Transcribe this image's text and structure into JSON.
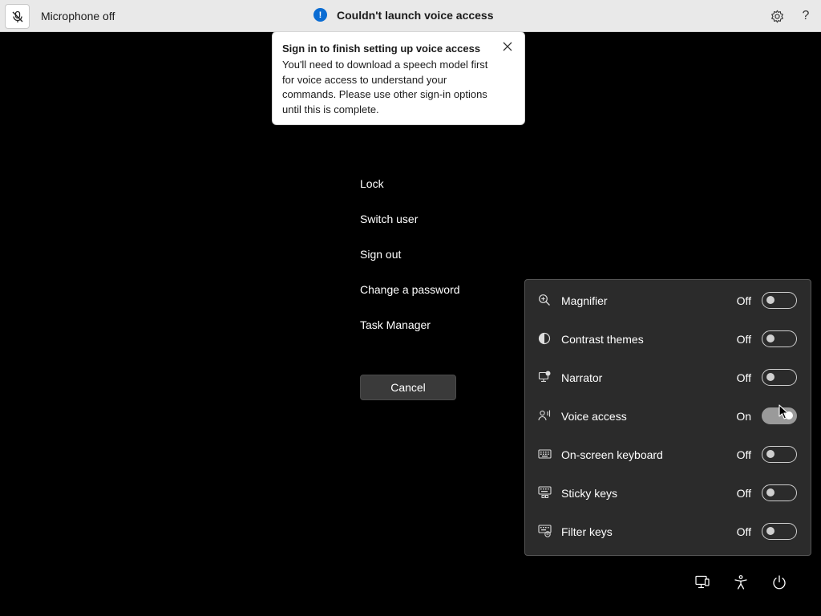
{
  "topbar": {
    "mic_label": "Microphone off",
    "mic_icon": "microphone-off-icon",
    "status": "Couldn't launch voice access",
    "status_icon": "info-icon",
    "settings_icon": "gear-icon",
    "help_label": "?"
  },
  "popup": {
    "title": "Sign in to finish setting up voice access",
    "body": "You'll need to download a speech model first for voice access to understand your commands. Please use other sign-in options until this is complete.",
    "close_icon": "close-icon"
  },
  "menu": {
    "items": [
      {
        "label": "Lock"
      },
      {
        "label": "Switch user"
      },
      {
        "label": "Sign out"
      },
      {
        "label": "Change a password"
      },
      {
        "label": "Task Manager"
      }
    ],
    "cancel_label": "Cancel"
  },
  "accessibility": {
    "items": [
      {
        "label": "Magnifier",
        "state": "Off",
        "on": false,
        "icon": "magnifier-icon"
      },
      {
        "label": "Contrast themes",
        "state": "Off",
        "on": false,
        "icon": "contrast-icon"
      },
      {
        "label": "Narrator",
        "state": "Off",
        "on": false,
        "icon": "narrator-icon"
      },
      {
        "label": "Voice access",
        "state": "On",
        "on": true,
        "icon": "voice-access-icon"
      },
      {
        "label": "On-screen keyboard",
        "state": "Off",
        "on": false,
        "icon": "keyboard-icon"
      },
      {
        "label": "Sticky keys",
        "state": "Off",
        "on": false,
        "icon": "sticky-keys-icon"
      },
      {
        "label": "Filter keys",
        "state": "Off",
        "on": false,
        "icon": "filter-keys-icon"
      }
    ]
  },
  "bottom": {
    "network_icon": "network-icon",
    "accessibility_icon": "accessibility-icon",
    "power_icon": "power-icon"
  },
  "colors": {
    "accent": "#0a6cd3",
    "background": "#000000",
    "flyout": "#2b2b2b"
  }
}
